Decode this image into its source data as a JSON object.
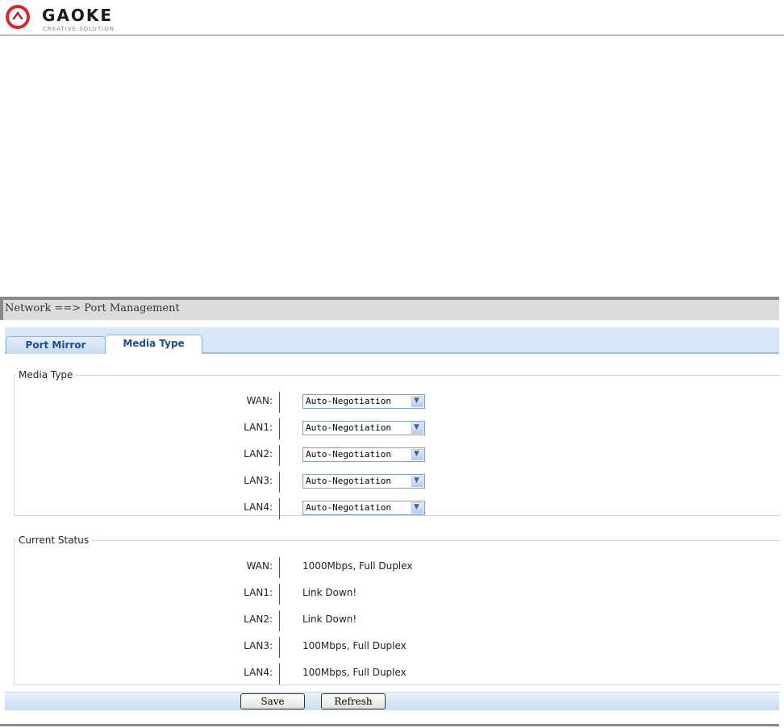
{
  "header": {
    "logo_text": "GAOKE",
    "logo_subtitle": "CREATIVE SOLUTION"
  },
  "breadcrumb": "Network ==> Port Management",
  "tabs": [
    {
      "label": "Port Mirror",
      "active": false
    },
    {
      "label": "Media Type",
      "active": true
    }
  ],
  "media_type": {
    "legend": "Media Type",
    "rows": [
      {
        "label": "WAN:",
        "value": "Auto-Negotiation"
      },
      {
        "label": "LAN1:",
        "value": "Auto-Negotiation"
      },
      {
        "label": "LAN2:",
        "value": "Auto-Negotiation"
      },
      {
        "label": "LAN3:",
        "value": "Auto-Negotiation"
      },
      {
        "label": "LAN4:",
        "value": "Auto-Negotiation"
      }
    ]
  },
  "current_status": {
    "legend": "Current Status",
    "rows": [
      {
        "label": "WAN:",
        "value": "1000Mbps, Full Duplex"
      },
      {
        "label": "LAN1:",
        "value": "Link Down!"
      },
      {
        "label": "LAN2:",
        "value": "Link Down!"
      },
      {
        "label": "LAN3:",
        "value": "100Mbps, Full Duplex"
      },
      {
        "label": "LAN4:",
        "value": "100Mbps, Full Duplex"
      }
    ]
  },
  "buttons": {
    "save": "Save",
    "refresh": "Refresh"
  },
  "colors": {
    "tab_text": "#1b4e99",
    "tabbar_bg": "#d7e7f8",
    "breadcrumb_bg": "#dcdcdc",
    "logo_red": "#d42a2a"
  }
}
